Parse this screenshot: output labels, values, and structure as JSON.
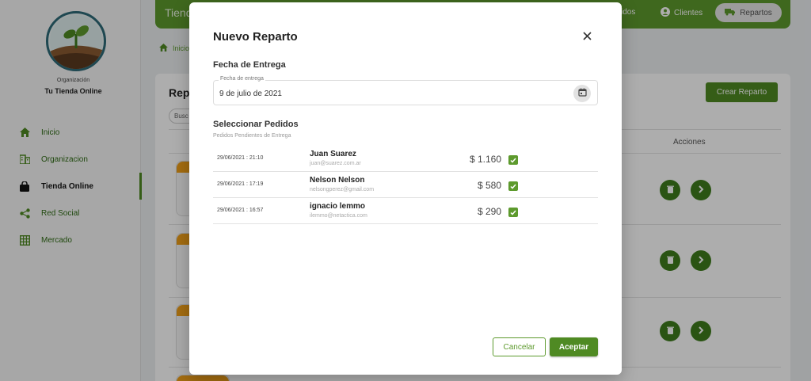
{
  "sidebar": {
    "org_label": "Organización",
    "org_name": "Tu Tienda Online",
    "items": [
      {
        "label": "Inicio",
        "icon": "home-icon"
      },
      {
        "label": "Organizacion",
        "icon": "building-icon"
      },
      {
        "label": "Tienda Online",
        "icon": "shopping-bag-icon",
        "active": true
      },
      {
        "label": "Red Social",
        "icon": "share-icon"
      },
      {
        "label": "Mercado",
        "icon": "grid-icon"
      }
    ]
  },
  "topbar": {
    "title": "Tienda",
    "pedidos": "idos",
    "clientes": "Clientes",
    "repartos": "Repartos"
  },
  "breadcrumb": {
    "label": "Inicio"
  },
  "main": {
    "title": "Rep",
    "search": "Busc",
    "create_button": "Crear Reparto",
    "actions_header": "Acciones"
  },
  "modal": {
    "title": "Nuevo Reparto",
    "delivery_section": "Fecha de Entrega",
    "date_label": "Fecha de entrega",
    "date_value": "9 de julio de 2021",
    "orders_section": "Seleccionar Pedidos",
    "orders_sublabel": "Pedidos Pendientes de Entrega",
    "orders": [
      {
        "date": "29/06/2021 : 21:10",
        "name": "Juan Suarez",
        "email": "juan@suarez.com.ar",
        "amount": "$ 1.160",
        "checked": true
      },
      {
        "date": "29/06/2021 : 17:19",
        "name": "Nelson Nelson",
        "email": "nelsongperez@gmail.com",
        "amount": "$ 580",
        "checked": true
      },
      {
        "date": "29/06/2021 : 16:57",
        "name": "ignacio lemmo",
        "email": "ilemmo@netactica.com",
        "amount": "$ 290",
        "checked": true
      }
    ],
    "cancel_label": "Cancelar",
    "accept_label": "Aceptar"
  },
  "colors": {
    "primary": "#5d9a2d",
    "primary_dark": "#4f8a23",
    "accent_orange": "#f0a018"
  }
}
